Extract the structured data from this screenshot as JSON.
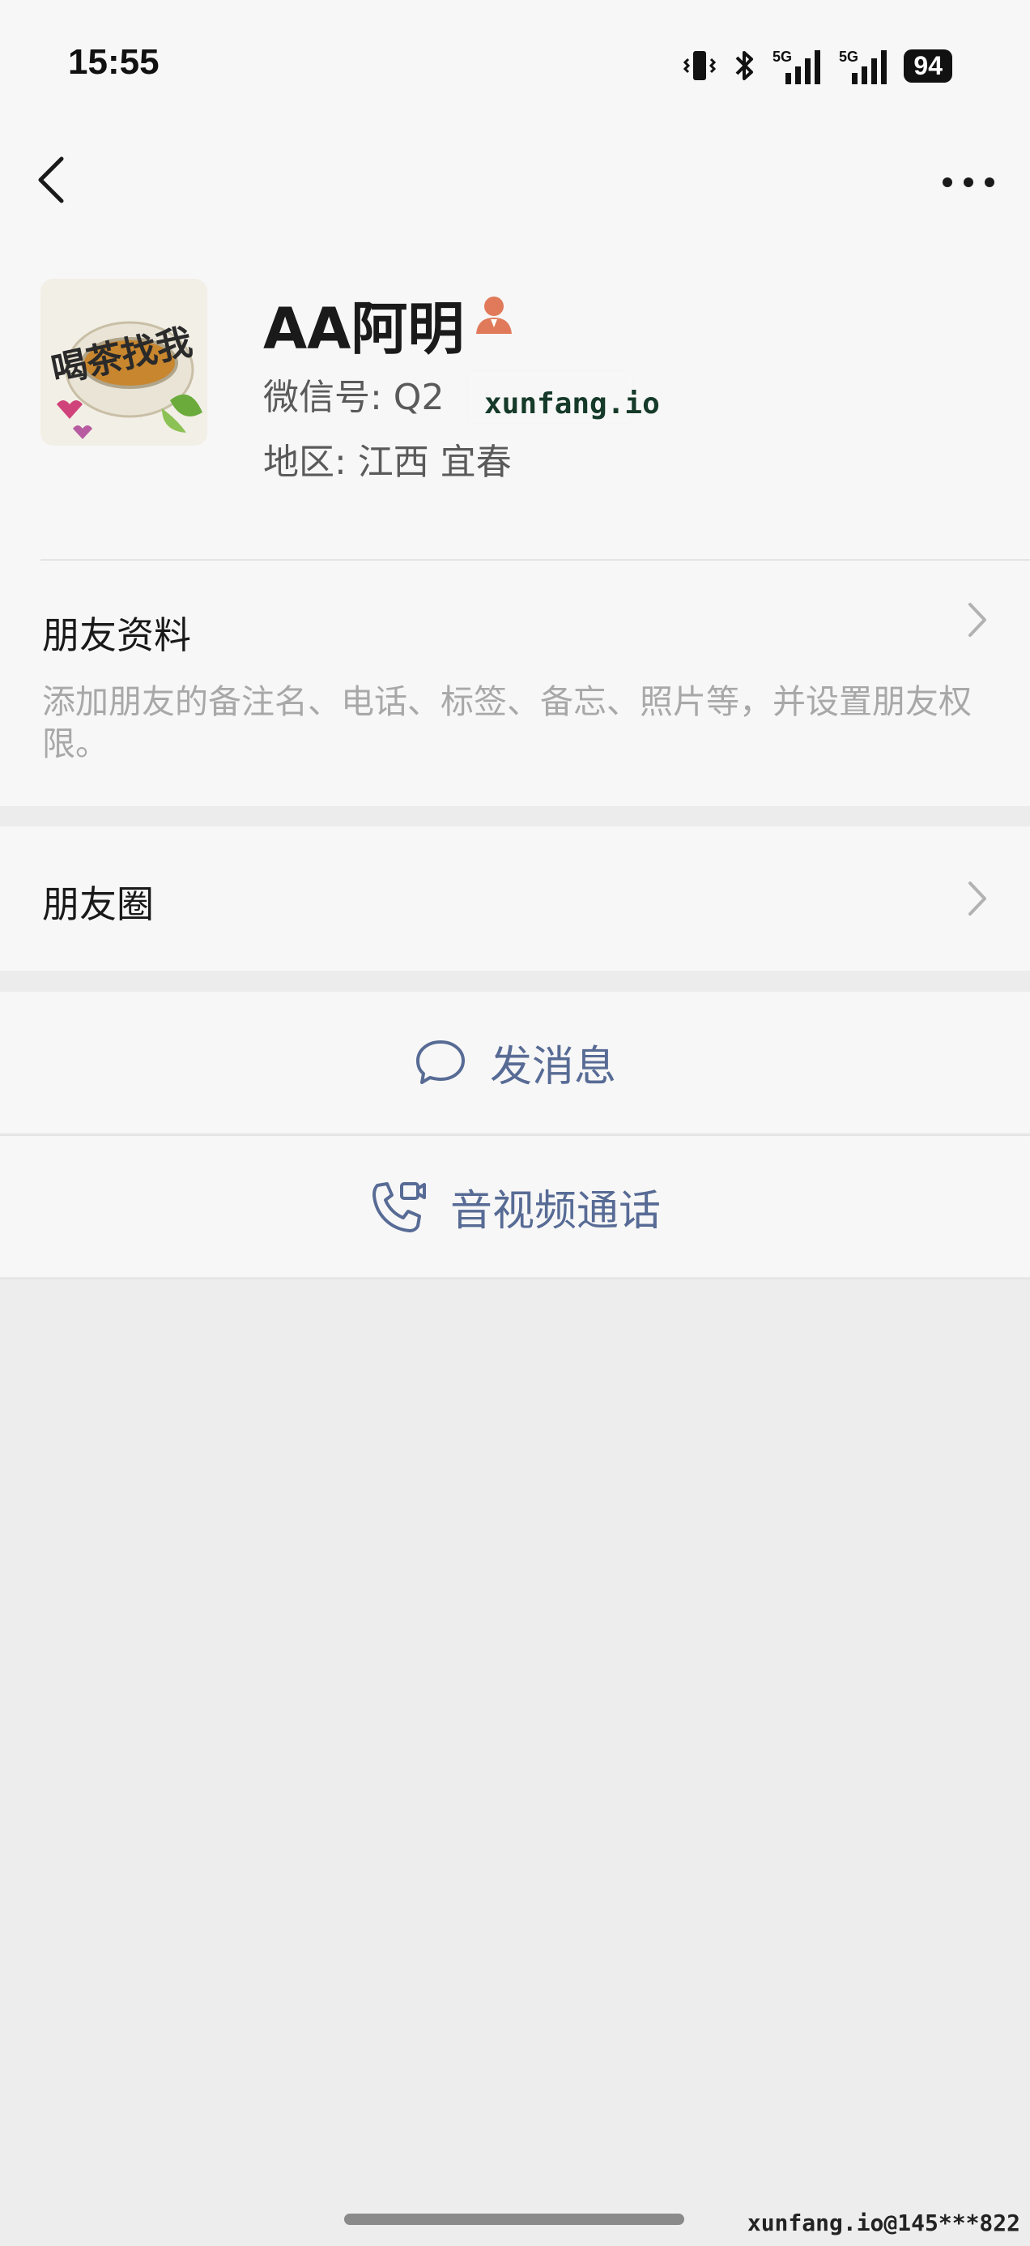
{
  "status": {
    "time": "15:55",
    "battery": "94",
    "network1": "5G",
    "network2": "5G"
  },
  "nav": {
    "back_icon": "chevron-left-icon",
    "more_icon": "more-dots-icon"
  },
  "profile": {
    "name": "AA阿明",
    "wechat_id_label": "微信号: Q2",
    "region_label": "地区: 江西  宜春",
    "avatar_text": "喝茶找我"
  },
  "friend_info": {
    "title": "朋友资料",
    "description": "添加朋友的备注名、电话、标签、备忘、照片等，并设置朋友权限。"
  },
  "moments": {
    "title": "朋友圈"
  },
  "actions": {
    "message": "发消息",
    "call": "音视频通话"
  },
  "watermarks": {
    "center": "xunfang.io",
    "corner": "xunfang.io@145***822"
  },
  "colors": {
    "link_blue": "#576b95",
    "background": "#ededed",
    "card": "#f7f7f7"
  }
}
